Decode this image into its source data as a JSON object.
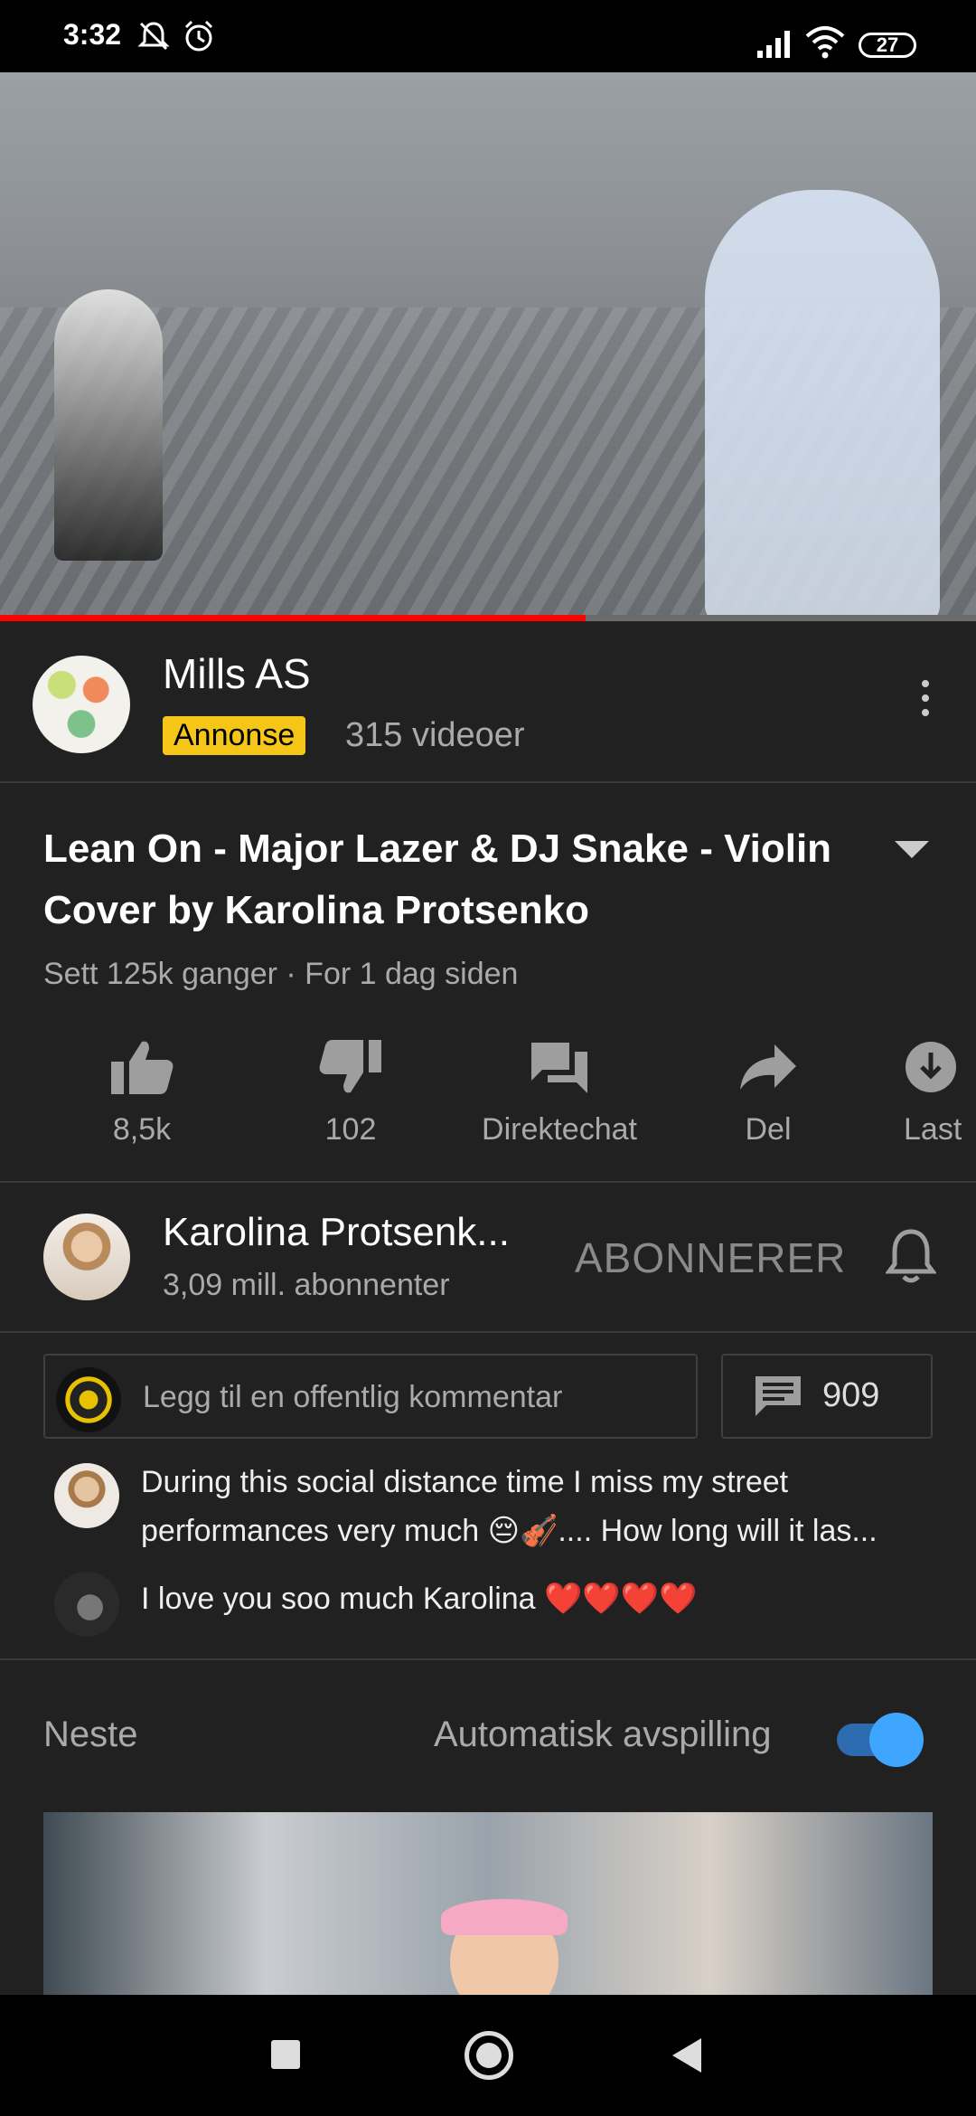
{
  "status_bar": {
    "time": "3:32",
    "battery": "27"
  },
  "video": {
    "progress_fraction": 0.6
  },
  "ad": {
    "channel": "Mills AS",
    "badge": "Annonse",
    "video_count": "315 videoer"
  },
  "video_info": {
    "title": "Lean On - Major Lazer & DJ Snake - Violin Cover by Karolina Protsenko",
    "meta": "Sett 125k ganger · For 1 dag siden"
  },
  "actions": [
    {
      "label": "8,5k",
      "icon": "thumb-up-icon"
    },
    {
      "label": "102",
      "icon": "thumb-down-icon"
    },
    {
      "label": "Direktechat",
      "icon": "chat-icon"
    },
    {
      "label": "Del",
      "icon": "share-icon"
    },
    {
      "label": "Last",
      "icon": "download-icon"
    }
  ],
  "channel": {
    "name": "Karolina Protsenk...",
    "subscribers": "3,09 mill. abonnenter",
    "subscribe_label": "ABONNERER"
  },
  "comments": {
    "placeholder": "Legg til en offentlig kommentar",
    "count": "909",
    "items": [
      {
        "text": "During this social distance time I miss my street performances very much 😔🎻.... How long will it las..."
      },
      {
        "text": "I love you soo much Karolina ❤️❤️❤️❤️"
      }
    ]
  },
  "up_next": {
    "label": "Neste",
    "autoplay_label": "Automatisk avspilling",
    "autoplay_on": true
  },
  "colors": {
    "accent": "#3ea6ff",
    "progress": "#ff0000",
    "ad_badge": "#f5c518",
    "background": "#212121"
  }
}
